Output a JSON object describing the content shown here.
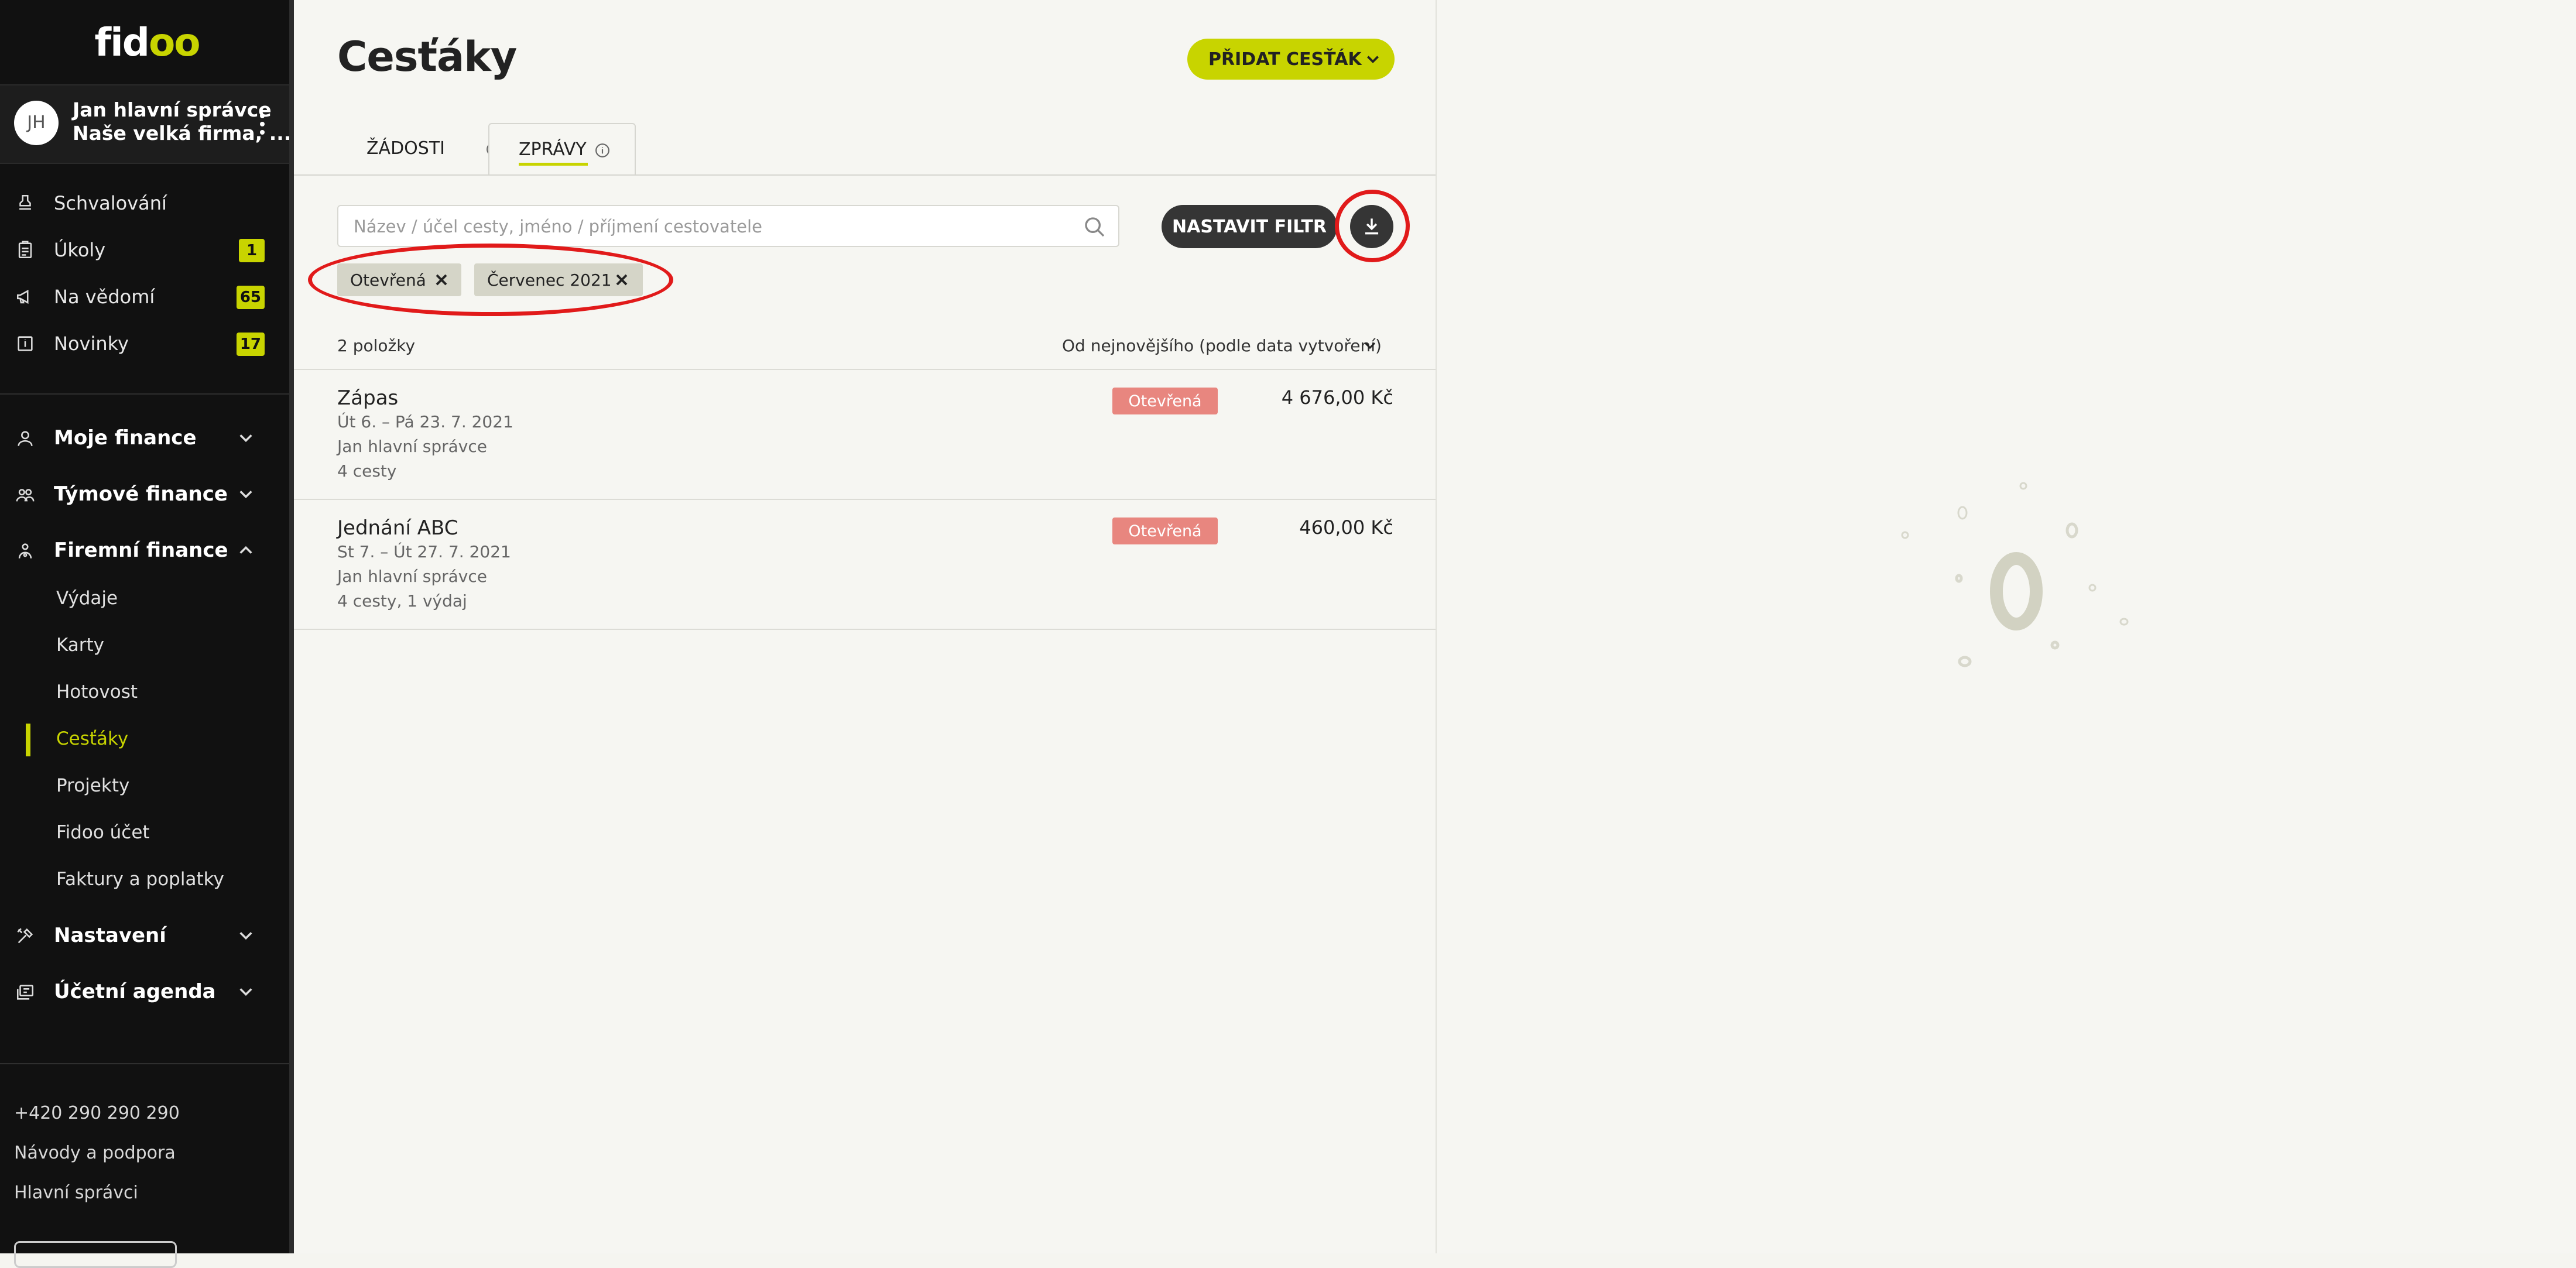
{
  "app": {
    "logo_main": "fid",
    "logo_accent": "oo"
  },
  "user": {
    "initials": "JH",
    "name": "Jan hlavní správce",
    "company": "Naše velká firma, ..."
  },
  "sidebar": {
    "top_items": [
      {
        "label": "Schvalování",
        "icon": "stamp-icon",
        "badge": ""
      },
      {
        "label": "Úkoly",
        "icon": "clipboard-icon",
        "badge": "1"
      },
      {
        "label": "Na vědomí",
        "icon": "megaphone-icon",
        "badge": "65"
      },
      {
        "label": "Novinky",
        "icon": "news-icon",
        "badge": "17"
      }
    ],
    "groups": [
      {
        "label": "Moje finance",
        "icon": "user-icon",
        "expanded": false
      },
      {
        "label": "Týmové finance",
        "icon": "team-icon",
        "expanded": false
      },
      {
        "label": "Firemní finance",
        "icon": "company-icon",
        "expanded": true
      }
    ],
    "company_sub_items": [
      {
        "label": "Výdaje",
        "active": false
      },
      {
        "label": "Karty",
        "active": false
      },
      {
        "label": "Hotovost",
        "active": false
      },
      {
        "label": "Cesťáky",
        "active": true
      },
      {
        "label": "Projekty",
        "active": false
      },
      {
        "label": "Fidoo účet",
        "active": false
      },
      {
        "label": "Faktury a poplatky",
        "active": false
      }
    ],
    "bottom_groups": [
      {
        "label": "Nastavení",
        "icon": "tools-icon"
      },
      {
        "label": "Účetní agenda",
        "icon": "accounting-icon"
      }
    ],
    "footer": {
      "phone": "+420 290 290 290",
      "help": "Návody a podpora",
      "admins": "Hlavní správci"
    },
    "accent_color": "#c8d400"
  },
  "main": {
    "title": "Cesťáky",
    "add_button": "PŘIDAT CESŤÁK",
    "tabs": [
      {
        "label": "ŽÁDOSTI",
        "active": false
      },
      {
        "label": "ZPRÁVY",
        "active": true
      }
    ],
    "search": {
      "placeholder": "Název / účel cesty, jméno / příjmení cestovatele",
      "value": ""
    },
    "filter_button": "NASTAVIT FILTR",
    "download_icon": "download-icon",
    "active_filters": [
      {
        "label": "Otevřená"
      },
      {
        "label": "Červenec 2021"
      }
    ],
    "count_label": "2 položky",
    "sort_label": "Od nejnovějšího (podle data vytvoření)",
    "reports": [
      {
        "title": "Zápas",
        "dates": "Út 6. – Pá 23. 7. 2021",
        "person": "Jan hlavní správce",
        "details": "4 cesty",
        "status": "Otevřená",
        "amount": "4 676,00 Kč"
      },
      {
        "title": "Jednání ABC",
        "dates": "St 7. – Út 27. 7. 2021",
        "person": "Jan hlavní správce",
        "details": "4 cesty, 1 výdaj",
        "status": "Otevřená",
        "amount": "460,00 Kč"
      }
    ],
    "status_color": "#e8867f",
    "annotation_color": "#e11a1a"
  },
  "detail": {
    "empty_icon": "fidoo-empty-illustration"
  }
}
